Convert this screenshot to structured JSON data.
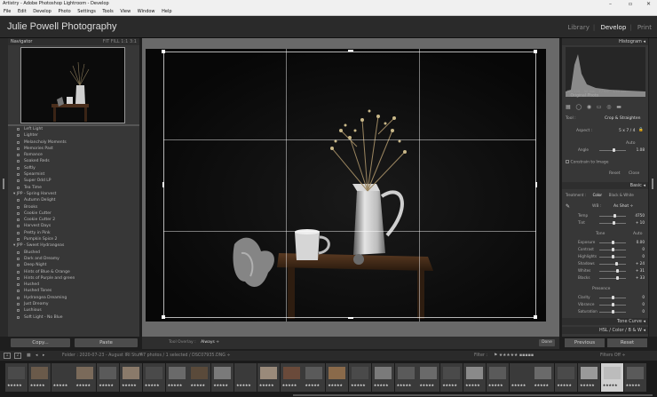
{
  "window": {
    "title": "Artistry - Adobe Photoshop Lightroom - Develop"
  },
  "menu": [
    "File",
    "Edit",
    "Develop",
    "Photo",
    "Settings",
    "Tools",
    "View",
    "Window",
    "Help"
  ],
  "identity_plate": "Julie Powell Photography",
  "modules": [
    "Library",
    "Develop",
    "Print"
  ],
  "navigator": {
    "title": "Navigator",
    "zoom": "FIT  FILL  1:1  3:1"
  },
  "presets": [
    {
      "label": "Left Light",
      "folder": false
    },
    {
      "label": "Lighter",
      "folder": false
    },
    {
      "label": "Melancholy Moments",
      "folder": false
    },
    {
      "label": "Memories Past",
      "folder": false
    },
    {
      "label": "Romance",
      "folder": false
    },
    {
      "label": "Soaked Reds",
      "folder": false
    },
    {
      "label": "Softly",
      "folder": false
    },
    {
      "label": "Spearmint",
      "folder": false
    },
    {
      "label": "Super Odd LP",
      "folder": false
    },
    {
      "label": "Tea Time",
      "folder": false
    },
    {
      "label": "▾  JPP - Spring Harvest",
      "folder": true
    },
    {
      "label": "Autumn Delight",
      "folder": false
    },
    {
      "label": "Brooks",
      "folder": false
    },
    {
      "label": "Cookie Cutter",
      "folder": false
    },
    {
      "label": "Cookie Cutter 2",
      "folder": false
    },
    {
      "label": "Harvest Days",
      "folder": false
    },
    {
      "label": "Pretty in Pink",
      "folder": false
    },
    {
      "label": "Pumpkin Spice 2",
      "folder": false
    },
    {
      "label": "▾  JPP - Sweet Hydrangeas",
      "folder": true
    },
    {
      "label": "Blushed",
      "folder": false
    },
    {
      "label": "Dark and Dreamy",
      "folder": false
    },
    {
      "label": "Deep Night",
      "folder": false
    },
    {
      "label": "Hints of Blue & Orange",
      "folder": false
    },
    {
      "label": "Hints of Purple and green",
      "folder": false
    },
    {
      "label": "Hushed",
      "folder": false
    },
    {
      "label": "Hushed Tones",
      "folder": false
    },
    {
      "label": "Hydrangea Dreaming",
      "folder": false
    },
    {
      "label": "Just Dreamy",
      "folder": false
    },
    {
      "label": "Lushious",
      "folder": false
    },
    {
      "label": "Soft Light - No Blue",
      "folder": false
    }
  ],
  "left_buttons": {
    "copy": "Copy...",
    "paste": "Paste"
  },
  "toolbar": {
    "overlay_label": "Tool Overlay :",
    "overlay_value": "Always ÷",
    "done": "Done"
  },
  "right": {
    "histogram": "Histogram ◂",
    "histo_readouts": [
      "ISO 200",
      "50 mm",
      "f / 4.0",
      "1/50 sec"
    ],
    "original_photo": "Original Photo",
    "tool_label": "Tool :",
    "crop_tool": "Crop & Straighten",
    "aspect_label": "Aspect :",
    "aspect_value": "5 x 7 / 4",
    "auto": "Auto",
    "angle_label": "Angle",
    "angle_value": "1.08",
    "constrain": "Constrain to Image",
    "reset": "Reset",
    "close": "Close",
    "basic": "Basic ◂",
    "treatment": [
      "Treatment :",
      "Color",
      "Black & White"
    ],
    "wb_label": "WB :",
    "wb_value": "As Shot ÷",
    "sliders_wb": [
      {
        "label": "Temp",
        "value": "4750",
        "pos": 0.55
      },
      {
        "label": "Tint",
        "value": "+ 10",
        "pos": 0.52
      }
    ],
    "tone_label": "Tone",
    "tone_auto": "Auto",
    "sliders_tone": [
      {
        "label": "Exposure",
        "value": "0.00",
        "pos": 0.5
      },
      {
        "label": "Contrast",
        "value": "0",
        "pos": 0.5
      },
      {
        "label": "Highlights",
        "value": "0",
        "pos": 0.5
      },
      {
        "label": "Shadows",
        "value": "+ 24",
        "pos": 0.62
      },
      {
        "label": "Whites",
        "value": "+ 31",
        "pos": 0.66
      },
      {
        "label": "Blacks",
        "value": "+ 33",
        "pos": 0.66
      }
    ],
    "presence_label": "Presence",
    "sliders_presence": [
      {
        "label": "Clarity",
        "value": "0",
        "pos": 0.5
      },
      {
        "label": "Vibrance",
        "value": "0",
        "pos": 0.5
      },
      {
        "label": "Saturation",
        "value": "0",
        "pos": 0.5
      }
    ],
    "tone_curve": "Tone Curve ◂",
    "hsl": "HSL / Color / B & W ◂",
    "previous": "Previous",
    "reset_btn": "Reset"
  },
  "filmstrip_header": {
    "pages": [
      "1",
      "2"
    ],
    "folder": "Folder : 2020-07-23 - August IRI Stuff",
    "photos": "47 photos / 1 selected / DSC07935.DNG ÷",
    "filter_label": "Filter :",
    "filters_off": "Filters Off ÷"
  },
  "filmstrip_thumbs": [
    {
      "stars": "★★★★★"
    },
    {
      "stars": "★★★★★"
    },
    {
      "stars": "★★★★★"
    },
    {
      "stars": "★★★★★"
    },
    {
      "stars": "★★★★★"
    },
    {
      "stars": "★★★★★"
    },
    {
      "stars": "★★★★★"
    },
    {
      "stars": "★★★★★"
    },
    {
      "stars": "★★★★★"
    },
    {
      "stars": "★★★★★"
    },
    {
      "stars": "★★★★★"
    },
    {
      "stars": "★★★★★"
    },
    {
      "stars": "★★★★★"
    },
    {
      "stars": "★★★★★"
    },
    {
      "stars": "★★★★★"
    },
    {
      "stars": "★★★★★"
    },
    {
      "stars": "★★★★★"
    },
    {
      "stars": "★★★★★"
    },
    {
      "stars": "★★★★★"
    },
    {
      "stars": "★★★★★"
    },
    {
      "stars": "★★★★★"
    },
    {
      "stars": "★★★★★"
    },
    {
      "stars": "★★★★★"
    },
    {
      "stars": "★★★★★"
    },
    {
      "stars": "★★★★★"
    },
    {
      "stars": "★★★★★"
    },
    {
      "stars": "★★★★★"
    },
    {
      "stars": "★★★★★"
    }
  ]
}
